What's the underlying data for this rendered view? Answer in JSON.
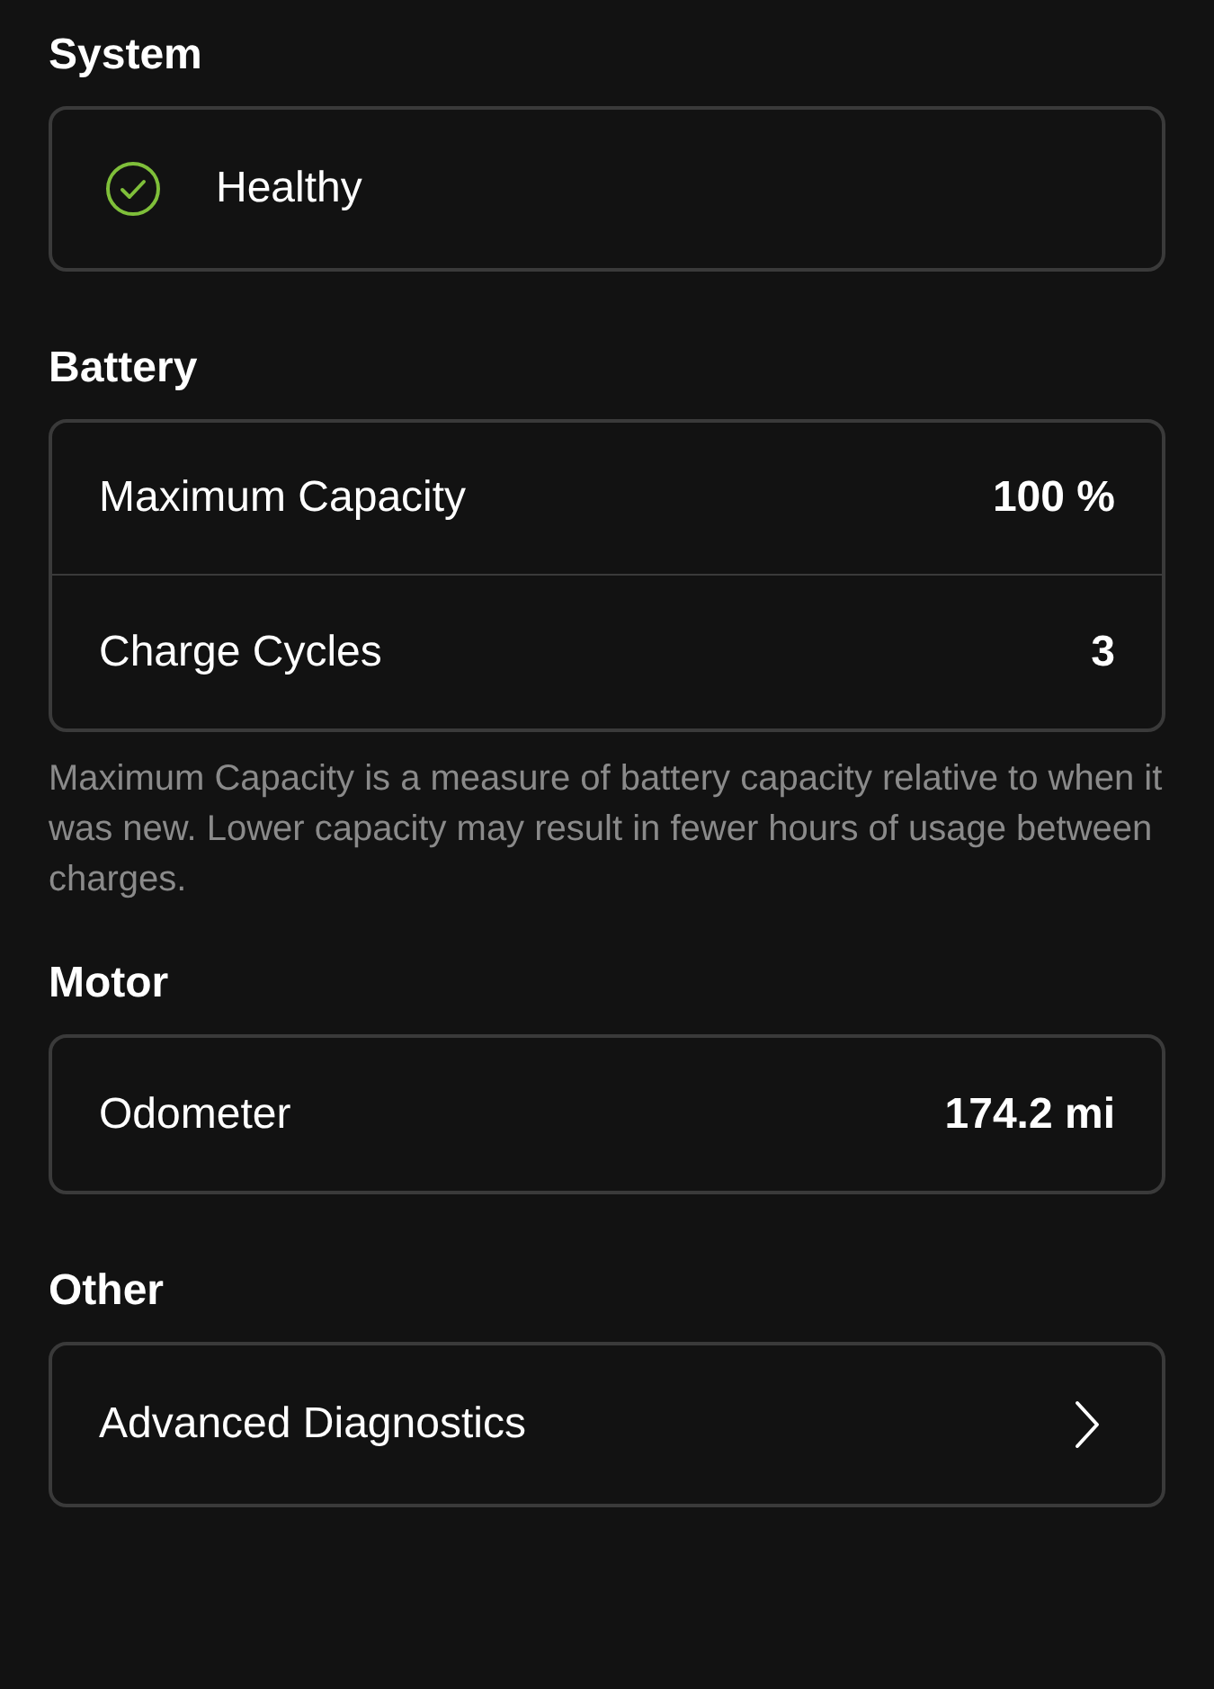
{
  "sections": [
    {
      "heading": "System",
      "rows": [
        {
          "kind": "status",
          "label": "Healthy"
        }
      ]
    },
    {
      "heading": "Battery",
      "rows": [
        {
          "kind": "value",
          "label": "Maximum Capacity",
          "value": "100 %"
        },
        {
          "kind": "value",
          "label": "Charge Cycles",
          "value": "3"
        }
      ],
      "note": "Maximum Capacity is a measure of battery capacity relative to when it was new. Lower capacity may result in fewer hours of usage between charges."
    },
    {
      "heading": "Motor",
      "rows": [
        {
          "kind": "value",
          "label": "Odometer",
          "value": "174.2 mi"
        }
      ]
    },
    {
      "heading": "Other",
      "rows": [
        {
          "kind": "link",
          "label": "Advanced Diagnostics"
        }
      ]
    }
  ]
}
